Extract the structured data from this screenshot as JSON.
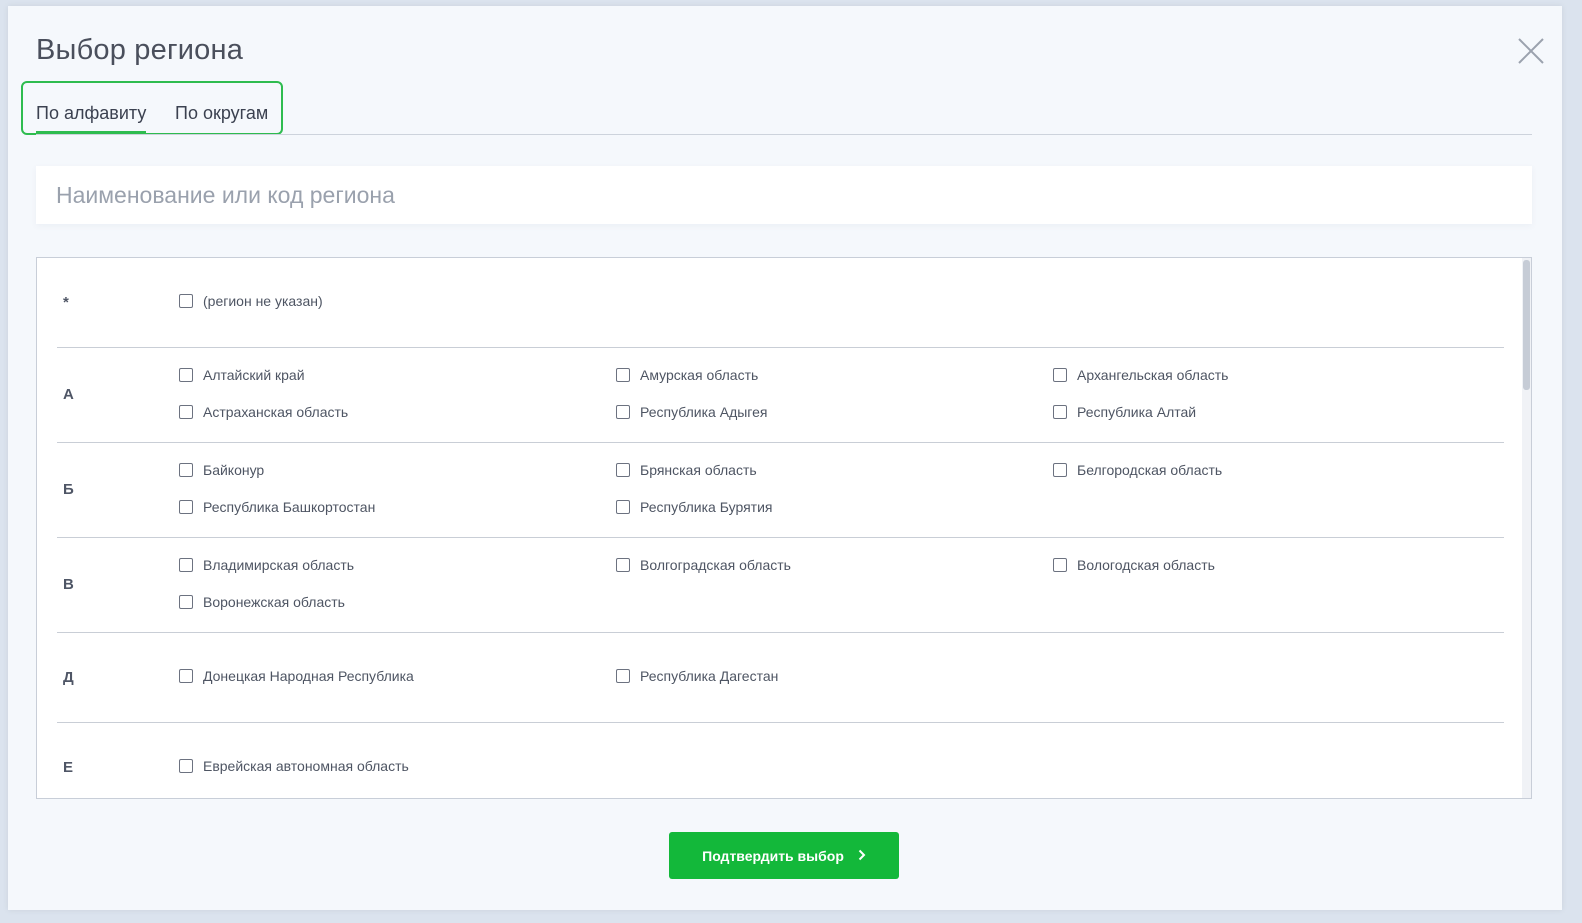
{
  "dialog": {
    "title": "Выбор региона",
    "close_icon": "close-icon"
  },
  "tabs": [
    {
      "label": "По алфавиту",
      "active": true
    },
    {
      "label": "По округам",
      "active": false
    }
  ],
  "search": {
    "placeholder": "Наименование или код региона",
    "value": ""
  },
  "groups": [
    {
      "letter": "*",
      "items": [
        {
          "label": "(регион не указан)",
          "checked": false
        }
      ]
    },
    {
      "letter": "А",
      "items": [
        {
          "label": "Алтайский край",
          "checked": false
        },
        {
          "label": "Амурская область",
          "checked": false
        },
        {
          "label": "Архангельская область",
          "checked": false
        },
        {
          "label": "Астраханская область",
          "checked": false
        },
        {
          "label": "Республика Адыгея",
          "checked": false
        },
        {
          "label": "Республика Алтай",
          "checked": false
        }
      ]
    },
    {
      "letter": "Б",
      "items": [
        {
          "label": "Байконур",
          "checked": false
        },
        {
          "label": "Брянская область",
          "checked": false
        },
        {
          "label": "Белгородская область",
          "checked": false
        },
        {
          "label": "Республика Башкортостан",
          "checked": false
        },
        {
          "label": "Республика Бурятия",
          "checked": false
        }
      ]
    },
    {
      "letter": "В",
      "items": [
        {
          "label": "Владимирская область",
          "checked": false
        },
        {
          "label": "Волгоградская область",
          "checked": false
        },
        {
          "label": "Вологодская область",
          "checked": false
        },
        {
          "label": "Воронежская область",
          "checked": false
        }
      ]
    },
    {
      "letter": "Д",
      "items": [
        {
          "label": "Донецкая Народная Республика",
          "checked": false
        },
        {
          "label": "Республика Дагестан",
          "checked": false
        }
      ]
    },
    {
      "letter": "Е",
      "items": [
        {
          "label": "Еврейская автономная область",
          "checked": false
        }
      ]
    }
  ],
  "confirm_button": {
    "label": "Подтвердить выбор",
    "icon": "chevron-right-icon"
  },
  "colors": {
    "accent": "#13b83a",
    "highlight_border": "#2ebc4f",
    "text": "#4e5563"
  }
}
